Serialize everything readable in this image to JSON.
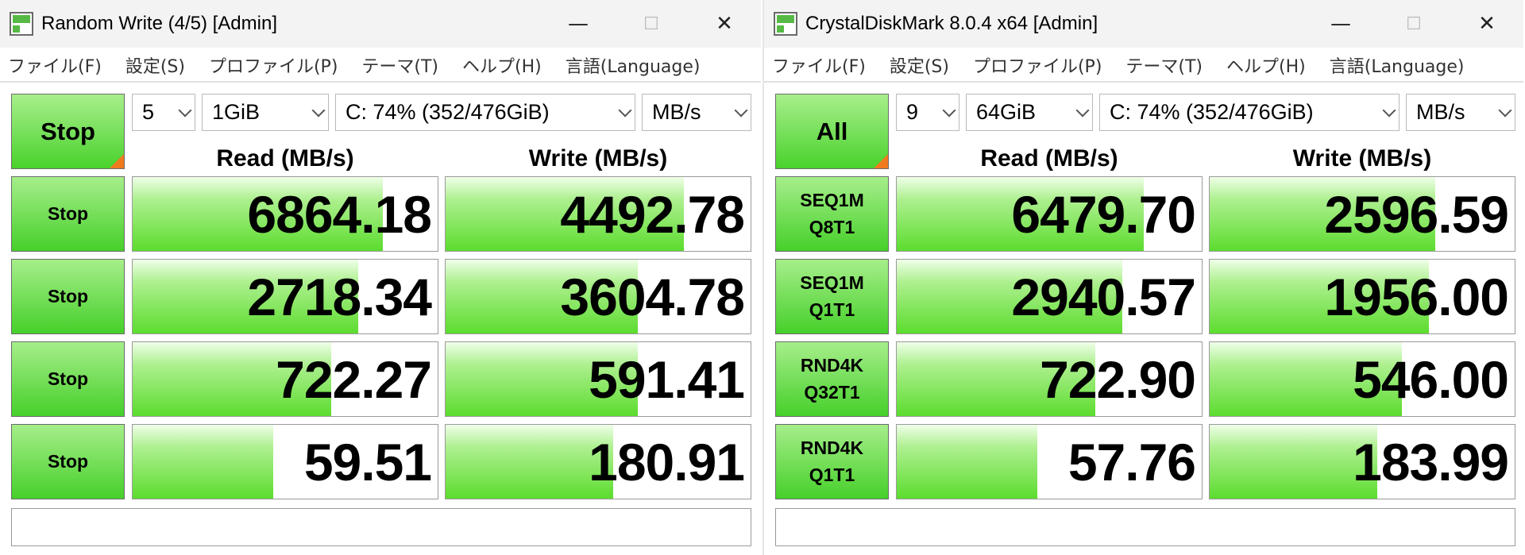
{
  "left": {
    "title": "Random Write (4/5) [Admin]",
    "caption": {
      "minimize": "—",
      "maximize": "☐",
      "close": "✕"
    },
    "menu": [
      "ファイル(F)",
      "設定(S)",
      "プロファイル(P)",
      "テーマ(T)",
      "ヘルプ(H)",
      "言語(Language)"
    ],
    "controls": {
      "count": "5",
      "size": "1GiB",
      "drive": "C: 74% (352/476GiB)",
      "unit": "MB/s"
    },
    "main_button": "Stop",
    "read_header": "Read (MB/s)",
    "write_header": "Write (MB/s)",
    "rows": [
      {
        "btn1": "Stop",
        "btn2": "",
        "read": "6864.18",
        "write": "4492.78",
        "read_fill": 0.82,
        "write_fill": 0.78
      },
      {
        "btn1": "Stop",
        "btn2": "",
        "read": "2718.34",
        "write": "3604.78",
        "read_fill": 0.74,
        "write_fill": 0.63
      },
      {
        "btn1": "Stop",
        "btn2": "",
        "read": "722.27",
        "write": "591.41",
        "read_fill": 0.65,
        "write_fill": 0.63
      },
      {
        "btn1": "Stop",
        "btn2": "",
        "read": "59.51",
        "write": "180.91",
        "read_fill": 0.46,
        "write_fill": 0.55
      }
    ],
    "status": ""
  },
  "right": {
    "title": "CrystalDiskMark 8.0.4 x64 [Admin]",
    "caption": {
      "minimize": "—",
      "maximize": "☐",
      "close": "✕"
    },
    "menu": [
      "ファイル(F)",
      "設定(S)",
      "プロファイル(P)",
      "テーマ(T)",
      "ヘルプ(H)",
      "言語(Language)"
    ],
    "controls": {
      "count": "9",
      "size": "64GiB",
      "drive": "C: 74% (352/476GiB)",
      "unit": "MB/s"
    },
    "main_button": "All",
    "read_header": "Read (MB/s)",
    "write_header": "Write (MB/s)",
    "rows": [
      {
        "btn1": "SEQ1M",
        "btn2": "Q8T1",
        "read": "6479.70",
        "write": "2596.59",
        "read_fill": 0.81,
        "write_fill": 0.74
      },
      {
        "btn1": "SEQ1M",
        "btn2": "Q1T1",
        "read": "2940.57",
        "write": "1956.00",
        "read_fill": 0.74,
        "write_fill": 0.72
      },
      {
        "btn1": "RND4K",
        "btn2": "Q32T1",
        "read": "722.90",
        "write": "546.00",
        "read_fill": 0.65,
        "write_fill": 0.63
      },
      {
        "btn1": "RND4K",
        "btn2": "Q1T1",
        "read": "57.76",
        "write": "183.99",
        "read_fill": 0.46,
        "write_fill": 0.55
      }
    ],
    "status": ""
  },
  "colors": {
    "bar_green": "#5cdc2e",
    "button_green": "#49d22c",
    "corner_orange": "#f07a1e"
  }
}
